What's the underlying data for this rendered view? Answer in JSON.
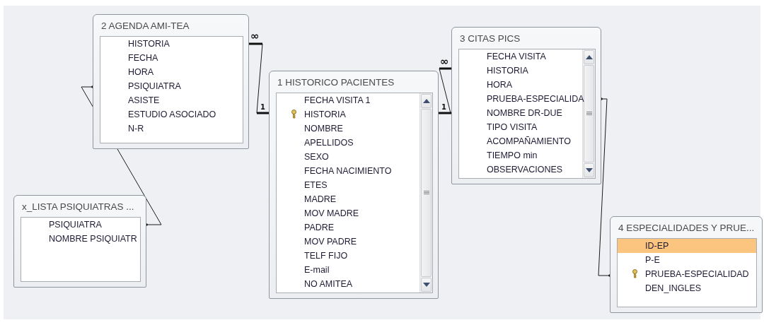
{
  "tables": [
    {
      "title": "2 AGENDA AMI-TEA",
      "fields": [
        {
          "name": "HISTORIA",
          "primary_key": false,
          "selected": false
        },
        {
          "name": "FECHA",
          "primary_key": false,
          "selected": false
        },
        {
          "name": "HORA",
          "primary_key": false,
          "selected": false
        },
        {
          "name": "PSIQUIATRA",
          "primary_key": false,
          "selected": false
        },
        {
          "name": "ASISTE",
          "primary_key": false,
          "selected": false
        },
        {
          "name": "ESTUDIO ASOCIADO",
          "primary_key": false,
          "selected": false
        },
        {
          "name": "N-R",
          "primary_key": false,
          "selected": false
        }
      ]
    },
    {
      "title": "1 HISTORICO PACIENTES",
      "fields": [
        {
          "name": "FECHA VISITA 1",
          "primary_key": false,
          "selected": false
        },
        {
          "name": "HISTORIA",
          "primary_key": true,
          "selected": false
        },
        {
          "name": "NOMBRE",
          "primary_key": false,
          "selected": false
        },
        {
          "name": "APELLIDOS",
          "primary_key": false,
          "selected": false
        },
        {
          "name": "SEXO",
          "primary_key": false,
          "selected": false
        },
        {
          "name": "FECHA NACIMIENTO",
          "primary_key": false,
          "selected": false
        },
        {
          "name": "ETES",
          "primary_key": false,
          "selected": false
        },
        {
          "name": "MADRE",
          "primary_key": false,
          "selected": false
        },
        {
          "name": "MOV MADRE",
          "primary_key": false,
          "selected": false
        },
        {
          "name": "PADRE",
          "primary_key": false,
          "selected": false
        },
        {
          "name": "MOV PADRE",
          "primary_key": false,
          "selected": false
        },
        {
          "name": "TELF FIJO",
          "primary_key": false,
          "selected": false
        },
        {
          "name": "E-mail",
          "primary_key": false,
          "selected": false
        },
        {
          "name": "NO AMITEA",
          "primary_key": false,
          "selected": false
        }
      ]
    },
    {
      "title": "3 CITAS PICS",
      "fields": [
        {
          "name": "FECHA VISITA",
          "primary_key": false,
          "selected": false
        },
        {
          "name": "HISTORIA",
          "primary_key": false,
          "selected": false
        },
        {
          "name": "HORA",
          "primary_key": false,
          "selected": false
        },
        {
          "name": "PRUEBA-ESPECIALIDA",
          "primary_key": false,
          "selected": false
        },
        {
          "name": "NOMBRE DR-DUE",
          "primary_key": false,
          "selected": false
        },
        {
          "name": "TIPO VISITA",
          "primary_key": false,
          "selected": false
        },
        {
          "name": "ACOMPAÑAMIENTO",
          "primary_key": false,
          "selected": false
        },
        {
          "name": "TIEMPO min",
          "primary_key": false,
          "selected": false
        },
        {
          "name": "OBSERVACIONES",
          "primary_key": false,
          "selected": false
        }
      ]
    },
    {
      "title": "x_LISTA PSIQUIATRAS ...",
      "fields": [
        {
          "name": "PSIQUIATRA",
          "primary_key": false,
          "selected": false
        },
        {
          "name": "NOMBRE PSIQUIATR",
          "primary_key": false,
          "selected": false
        }
      ]
    },
    {
      "title": "4 ESPECIALIDADES Y PRUE...",
      "fields": [
        {
          "name": "ID-EP",
          "primary_key": false,
          "selected": true
        },
        {
          "name": "P-E",
          "primary_key": false,
          "selected": false
        },
        {
          "name": "PRUEBA-ESPECIALIDAD",
          "primary_key": true,
          "selected": false
        },
        {
          "name": "DEN_INGLES",
          "primary_key": false,
          "selected": false
        }
      ]
    }
  ],
  "relationships": [
    {
      "kind": "one_to_many",
      "many_mark": "∞",
      "one_mark": "1"
    },
    {
      "kind": "one_to_many",
      "many_mark": "∞",
      "one_mark": "1"
    },
    {
      "kind": "plain"
    },
    {
      "kind": "plain"
    }
  ]
}
